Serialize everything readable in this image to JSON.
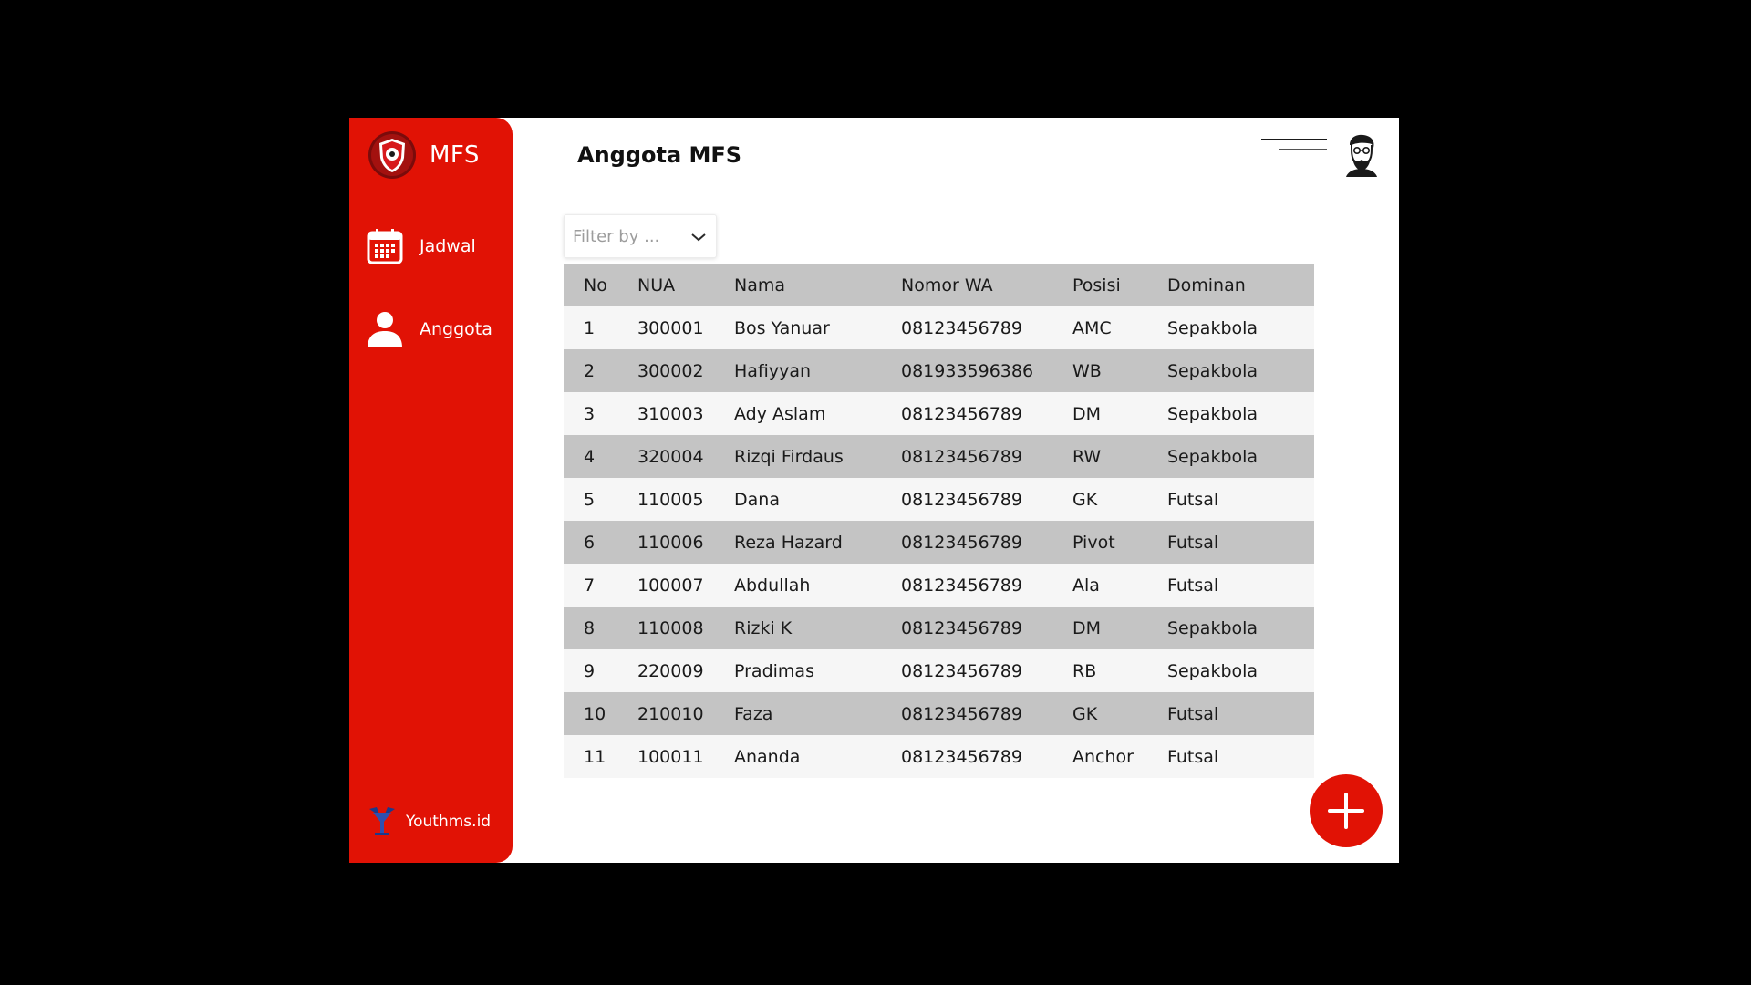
{
  "sidebar": {
    "brand": "MFS",
    "items": [
      {
        "label": "Jadwal",
        "icon": "calendar-icon"
      },
      {
        "label": "Anggota",
        "icon": "user-icon"
      }
    ],
    "footer": "Youthms.id"
  },
  "header": {
    "title": "Anggota MFS",
    "menu_icon": "menu-lines-icon",
    "avatar_icon": "bearded-man-avatar-icon"
  },
  "filter": {
    "placeholder": "Filter by ...",
    "icon": "chevron-down-icon"
  },
  "table": {
    "columns": [
      "No",
      "NUA",
      "Nama",
      "Nomor WA",
      "Posisi",
      "Dominan"
    ],
    "rows": [
      [
        "1",
        "300001",
        "Bos Yanuar",
        "08123456789",
        "AMC",
        "Sepakbola"
      ],
      [
        "2",
        "300002",
        "Hafiyyan",
        "081933596386",
        "WB",
        "Sepakbola"
      ],
      [
        "3",
        "310003",
        "Ady Aslam",
        "08123456789",
        "DM",
        "Sepakbola"
      ],
      [
        "4",
        "320004",
        "Rizqi Firdaus",
        "08123456789",
        "RW",
        "Sepakbola"
      ],
      [
        "5",
        "110005",
        "Dana",
        "08123456789",
        "GK",
        "Futsal"
      ],
      [
        "6",
        "110006",
        "Reza Hazard",
        "08123456789",
        "Pivot",
        "Futsal"
      ],
      [
        "7",
        "100007",
        "Abdullah",
        "08123456789",
        "Ala",
        "Futsal"
      ],
      [
        "8",
        "110008",
        "Rizki K",
        "08123456789",
        "DM",
        "Sepakbola"
      ],
      [
        "9",
        "220009",
        "Pradimas",
        "08123456789",
        "RB",
        "Sepakbola"
      ],
      [
        "10",
        "210010",
        "Faza",
        "08123456789",
        "GK",
        "Futsal"
      ],
      [
        "11",
        "100011",
        "Ananda",
        "08123456789",
        "Anchor",
        "Futsal"
      ]
    ]
  },
  "add_button": {
    "icon": "plus-icon"
  },
  "colors": {
    "accent": "#e11205",
    "background": "#000000",
    "row_shade": "#c4c4c4",
    "row_light": "#f6f6f6"
  }
}
